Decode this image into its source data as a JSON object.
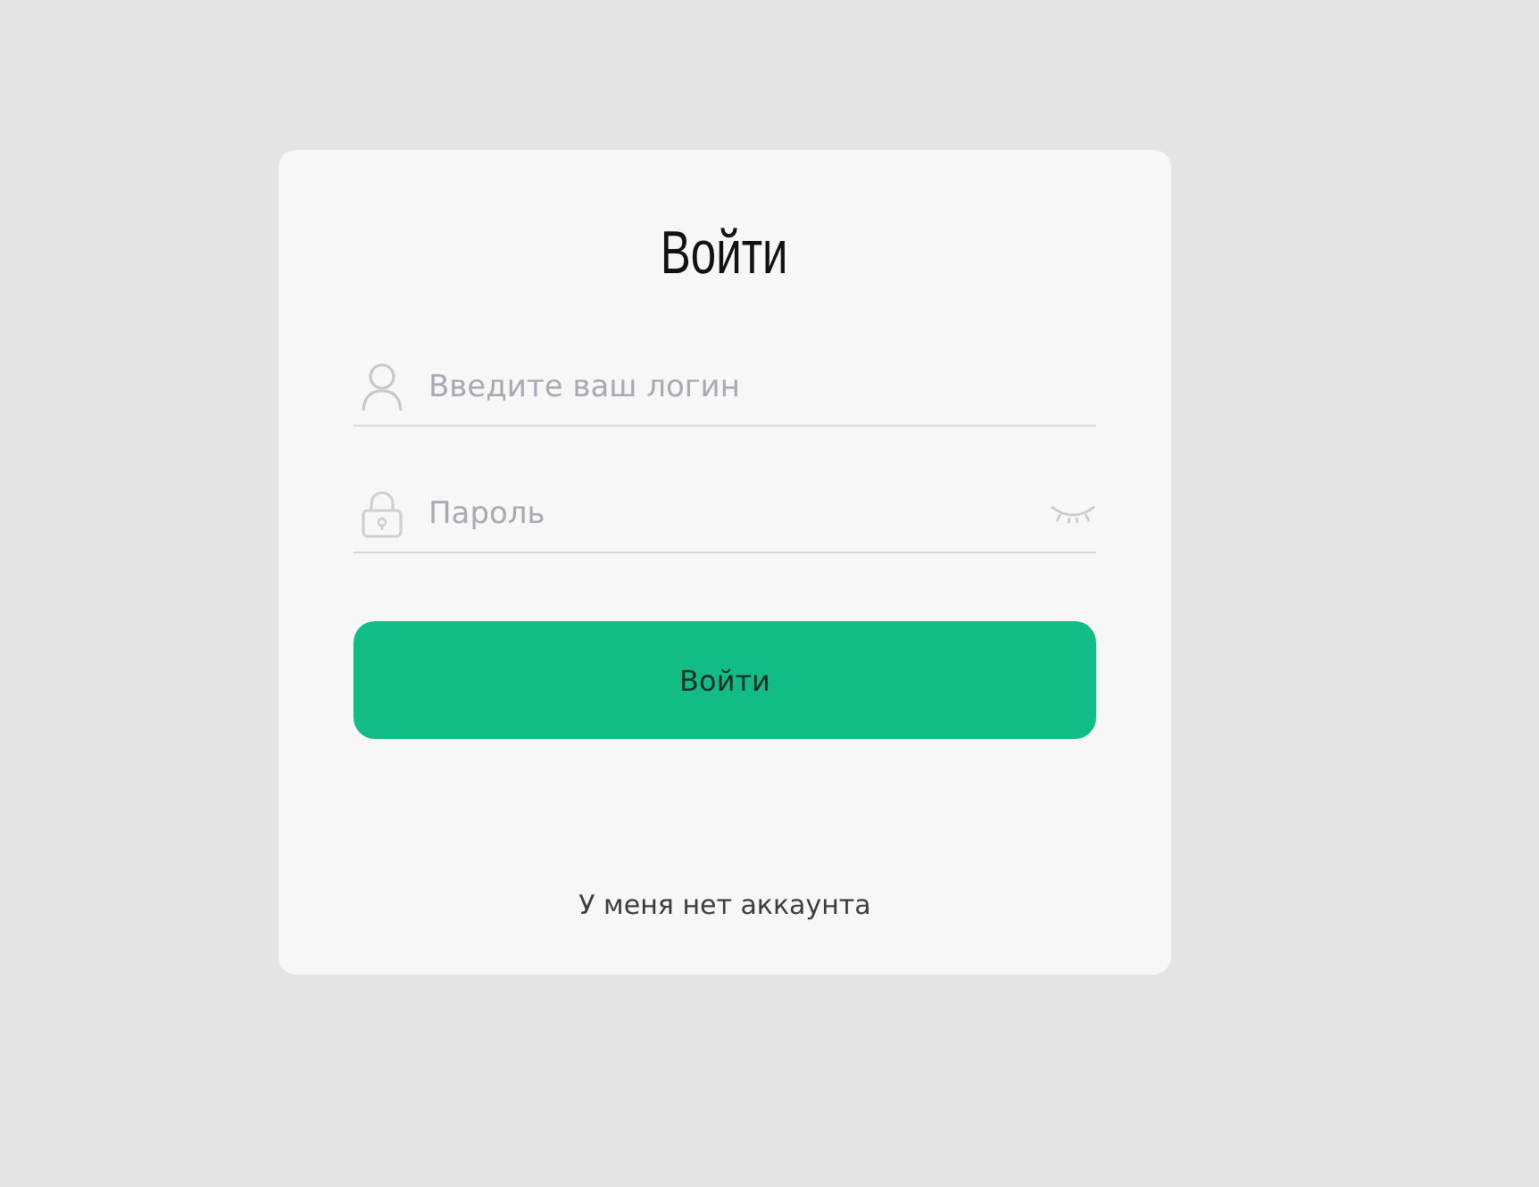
{
  "title": "Войти",
  "fields": [
    {
      "kind": "login",
      "placeholder": "Введите ваш логин"
    },
    {
      "kind": "password",
      "placeholder": "Пароль"
    }
  ],
  "submit_button": "Войти",
  "register_link": "У меня нет аккаунта"
}
